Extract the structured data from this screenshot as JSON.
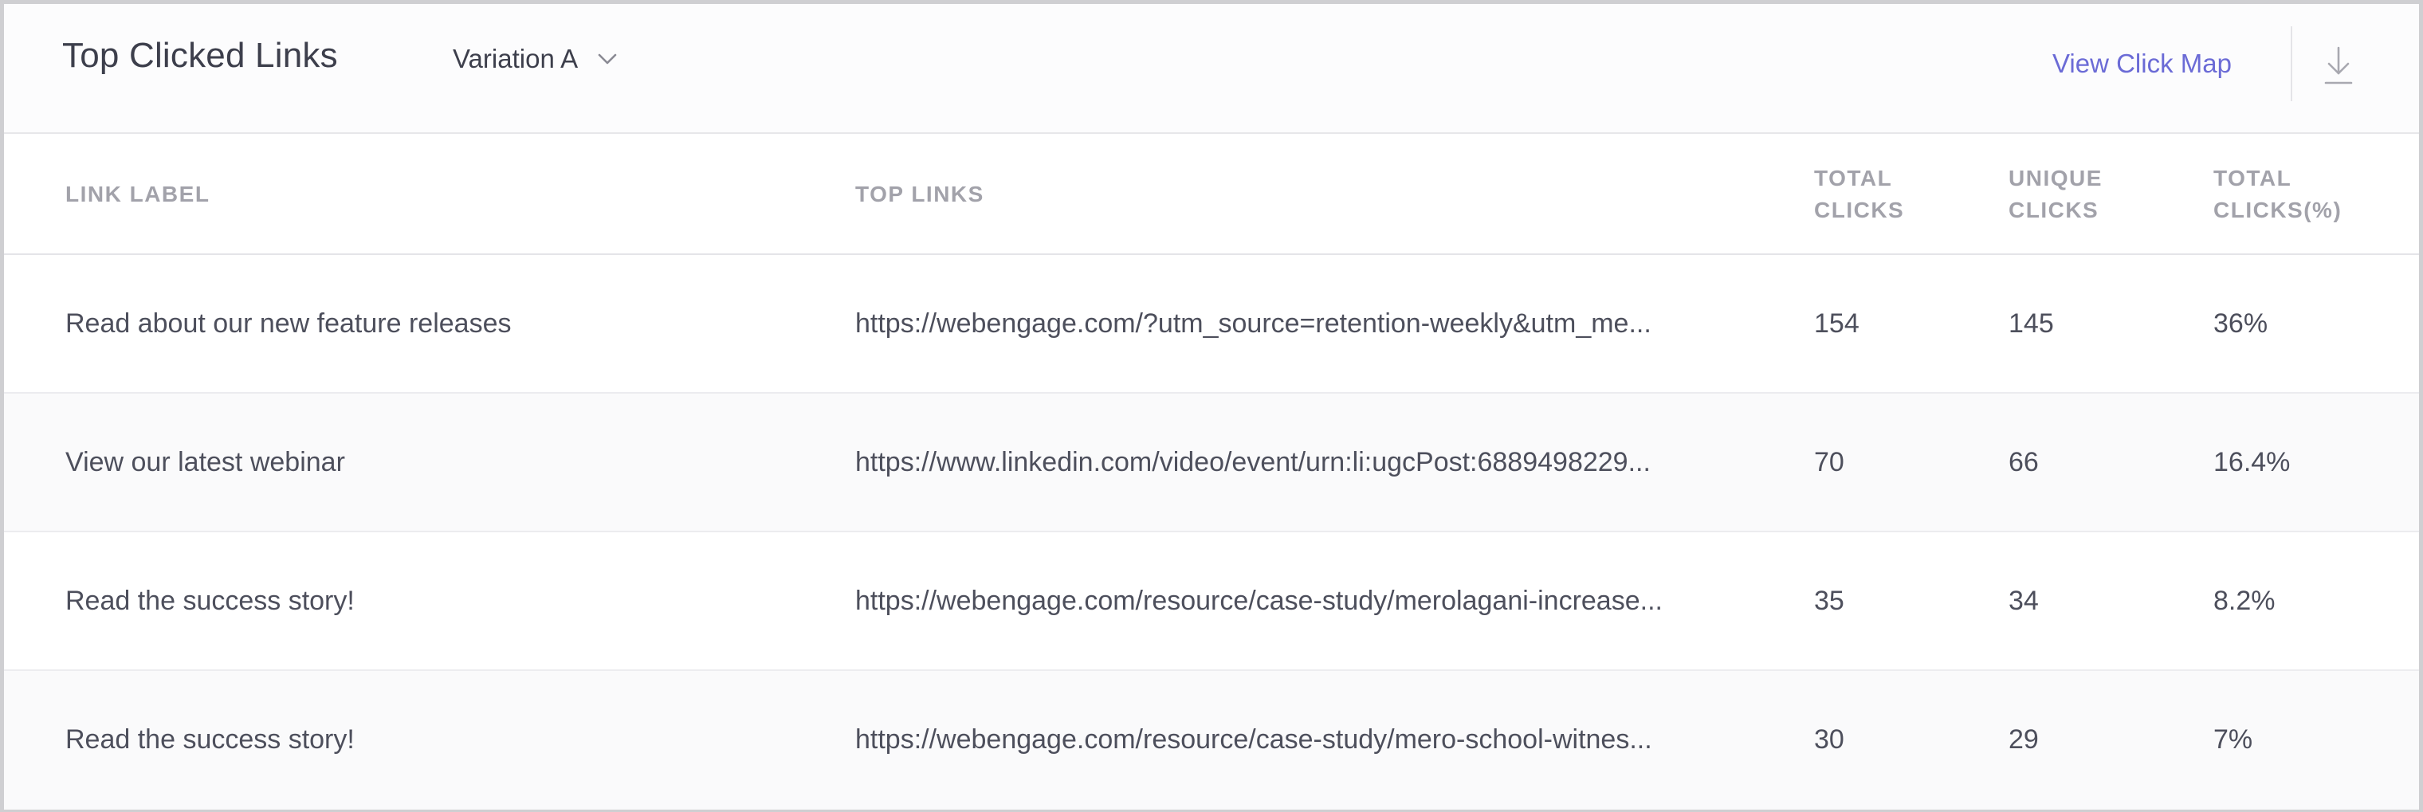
{
  "header": {
    "title": "Top Clicked Links",
    "variation_label": "Variation A",
    "view_click_map_label": "View Click Map"
  },
  "columns": {
    "link_label": "LINK LABEL",
    "top_links": "TOP LINKS",
    "total_clicks_line1": "TOTAL",
    "total_clicks_line2": "CLICKS",
    "unique_clicks_line1": "UNIQUE",
    "unique_clicks_line2": "CLICKS",
    "total_clicks_pct_line1": "TOTAL",
    "total_clicks_pct_line2": "CLICKS(%)"
  },
  "rows": [
    {
      "label": "Read about our new feature releases",
      "link": "https://webengage.com/?utm_source=retention-weekly&utm_me...",
      "total_clicks": "154",
      "unique_clicks": "145",
      "total_clicks_pct": "36%"
    },
    {
      "label": "View our latest webinar",
      "link": "https://www.linkedin.com/video/event/urn:li:ugcPost:6889498229...",
      "total_clicks": "70",
      "unique_clicks": "66",
      "total_clicks_pct": "16.4%"
    },
    {
      "label": "Read the success story!",
      "link": "https://webengage.com/resource/case-study/merolagani-increase...",
      "total_clicks": "35",
      "unique_clicks": "34",
      "total_clicks_pct": "8.2%"
    },
    {
      "label": "Read the success story!",
      "link": "https://webengage.com/resource/case-study/mero-school-witnes...",
      "total_clicks": "30",
      "unique_clicks": "29",
      "total_clicks_pct": "7%"
    }
  ],
  "colors": {
    "accent_link": "#6b6bd6",
    "text_primary": "#3d3f4c",
    "header_text_muted": "#a2a2aa",
    "row_alt_bg": "#fafafb"
  },
  "icons": {
    "variation_dropdown": "chevron-down-icon",
    "download": "download-icon"
  }
}
